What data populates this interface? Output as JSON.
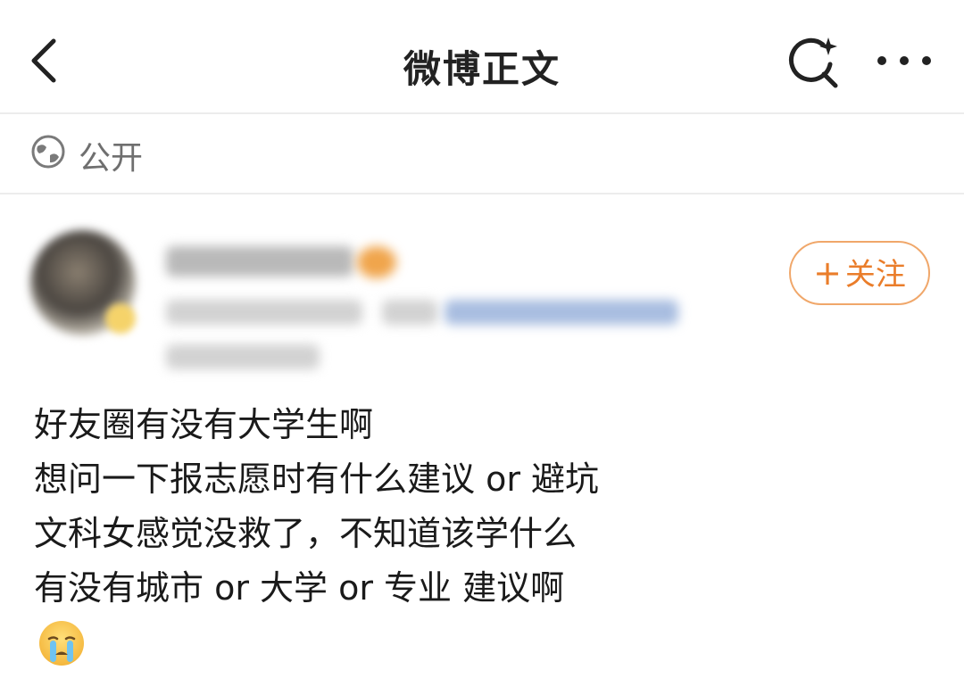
{
  "header": {
    "title": "微博正文",
    "icons": {
      "back": "chevron-left-icon",
      "search": "search-sparkle-icon",
      "more": "more-dots-icon"
    }
  },
  "visibility": {
    "icon": "globe-icon",
    "label": "公开"
  },
  "author": {
    "follow_label": "关注",
    "follow_plus": "+",
    "follow_color": "#ea7d2a"
  },
  "post": {
    "lines": [
      "好友圈有没有大学生啊",
      "想问一下报志愿时有什么建议 or 避坑",
      "文科女感觉没救了，不知道该学什么",
      "有没有城市 or 大学 or 专业 建议啊"
    ],
    "emoji": "crying-face-icon"
  },
  "colors": {
    "divider": "#ececec",
    "accent": "#ea7d2a",
    "muted": "#6f6f6f"
  }
}
